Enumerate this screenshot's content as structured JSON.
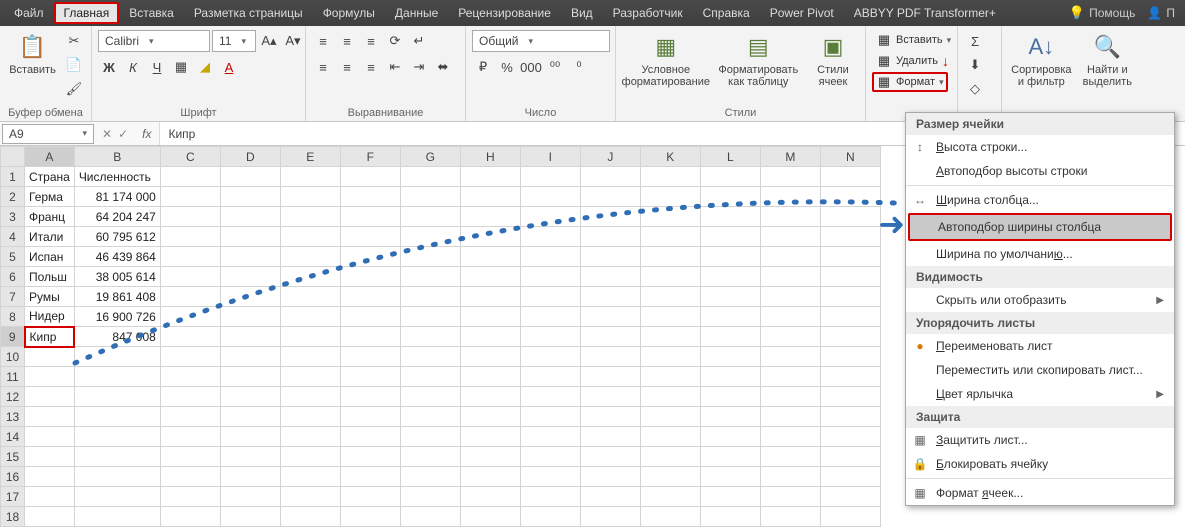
{
  "tabs": {
    "file": "Файл",
    "home": "Главная",
    "insert": "Вставка",
    "pagelayout": "Разметка страницы",
    "formulas": "Формулы",
    "data": "Данные",
    "review": "Рецензирование",
    "view": "Вид",
    "developer": "Разработчик",
    "help": "Справка",
    "powerpivot": "Power Pivot",
    "abbyy": "ABBYY PDF Transformer+",
    "tellme": "Помощь",
    "share": "П"
  },
  "ribbon": {
    "clipboard": {
      "title": "Буфер обмена",
      "paste": "Вставить"
    },
    "font": {
      "title": "Шрифт",
      "name": "Calibri",
      "size": "11"
    },
    "alignment": {
      "title": "Выравнивание"
    },
    "number": {
      "title": "Число",
      "format": "Общий"
    },
    "styles": {
      "title": "Стили",
      "conditional": "Условное форматирование",
      "table": "Форматировать как таблицу",
      "cellstyles": "Стили ячеек"
    },
    "cells": {
      "insert": "Вставить",
      "delete": "Удалить",
      "format": "Формат"
    },
    "editing": {
      "sort": "Сортировка и фильтр",
      "find": "Найти и выделить"
    }
  },
  "namebox": "A9",
  "formula": "Кипр",
  "columns": [
    "A",
    "B",
    "C",
    "D",
    "E",
    "F",
    "G",
    "H",
    "I",
    "J",
    "K",
    "L",
    "M",
    "N"
  ],
  "rows": [
    {
      "r": 1,
      "a": "Страна",
      "b": "Численность",
      "bnum": false
    },
    {
      "r": 2,
      "a": "Герма",
      "b": "81 174 000",
      "bnum": true
    },
    {
      "r": 3,
      "a": "Франц",
      "b": "64 204 247",
      "bnum": true
    },
    {
      "r": 4,
      "a": "Итали",
      "b": "60 795 612",
      "bnum": true
    },
    {
      "r": 5,
      "a": "Испан",
      "b": "46 439 864",
      "bnum": true
    },
    {
      "r": 6,
      "a": "Польш",
      "b": "38 005 614",
      "bnum": true
    },
    {
      "r": 7,
      "a": "Румы",
      "b": "19 861 408",
      "bnum": true
    },
    {
      "r": 8,
      "a": "Нидер",
      "b": "16 900 726",
      "bnum": true
    },
    {
      "r": 9,
      "a": "Кипр",
      "b": "847 008",
      "bnum": true
    }
  ],
  "extra_rows": [
    10,
    11,
    12,
    13,
    14,
    15,
    16,
    17,
    18
  ],
  "menu": {
    "sec1": "Размер ячейки",
    "rowheight": "Высота строки...",
    "autorow": "Автоподбор высоты строки",
    "colwidth": "Ширина столбца...",
    "autocol": "Автоподбор ширины столбца",
    "defwidth": "Ширина по умолчанию...",
    "sec2": "Видимость",
    "hide": "Скрыть или отобразить",
    "sec3": "Упорядочить листы",
    "rename": "Переименовать лист",
    "move": "Переместить или скопировать лист...",
    "tabcolor": "Цвет ярлычка",
    "sec4": "Защита",
    "protect": "Защитить лист...",
    "lock": "Блокировать ячейку",
    "cellformat": "Формат ячеек..."
  }
}
